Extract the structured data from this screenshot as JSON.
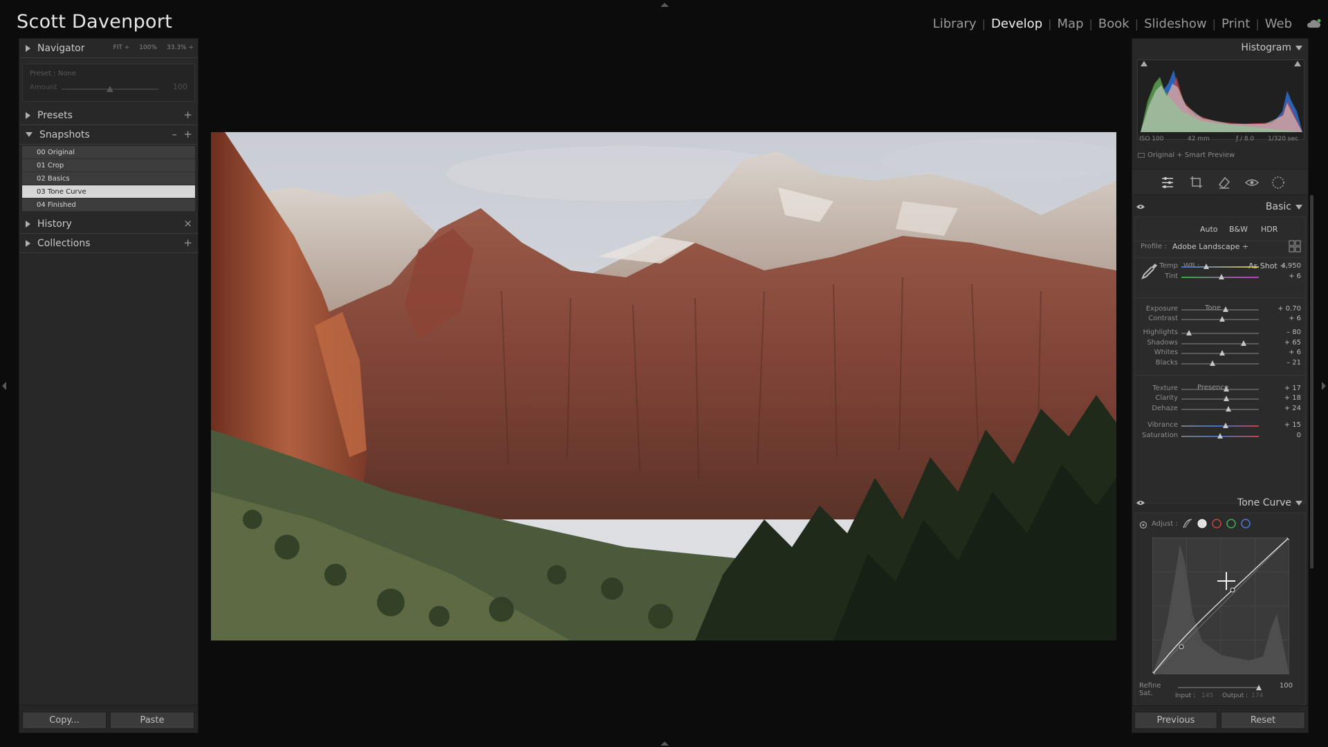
{
  "identity_plate": "Scott Davenport",
  "modules": [
    {
      "label": "Library",
      "active": false
    },
    {
      "label": "Develop",
      "active": true
    },
    {
      "label": "Map",
      "active": false
    },
    {
      "label": "Book",
      "active": false
    },
    {
      "label": "Slideshow",
      "active": false
    },
    {
      "label": "Print",
      "active": false
    },
    {
      "label": "Web",
      "active": false
    }
  ],
  "navigator": {
    "label": "Navigator",
    "zoom_options": [
      "FIT ÷",
      "100%",
      "33.3% ÷"
    ],
    "preset_text": "Preset : None",
    "amount_label": "Amount",
    "amount_value": "100"
  },
  "presets": {
    "label": "Presets",
    "action": "+"
  },
  "snapshots": {
    "label": "Snapshots",
    "actions": [
      "–",
      "+"
    ],
    "items": [
      "00 Original",
      "01 Crop",
      "02 Basics",
      "03 Tone Curve",
      "04 Finished"
    ],
    "selected_index": 3
  },
  "history": {
    "label": "History",
    "action": "×"
  },
  "collections": {
    "label": "Collections",
    "action": "+"
  },
  "left_buttons": {
    "copy": "Copy...",
    "paste": "Paste"
  },
  "histogram": {
    "label": "Histogram",
    "iso": "ISO 100",
    "focal": "42 mm",
    "aperture": "ƒ / 8.0",
    "shutter": "1/320 sec",
    "preview": "Original + Smart Preview"
  },
  "basic": {
    "label": "Basic",
    "buttons": [
      "Auto",
      "B&W",
      "HDR"
    ],
    "profile_label": "Profile :",
    "profile_value": "Adobe Landscape ÷",
    "wb_label": "WB :",
    "wb_value": "As Shot ÷",
    "tone_label": "Tone",
    "presence_label": "Presence",
    "sliders": [
      {
        "label": "Temp",
        "value": "4,950",
        "pos": 0.32
      },
      {
        "label": "Tint",
        "value": "+ 6",
        "pos": 0.52
      },
      {
        "label": "Exposure",
        "value": "+ 0.70",
        "pos": 0.57
      },
      {
        "label": "Contrast",
        "value": "+ 6",
        "pos": 0.53
      },
      {
        "label": "Highlights",
        "value": "– 80",
        "pos": 0.1
      },
      {
        "label": "Shadows",
        "value": "+ 65",
        "pos": 0.8
      },
      {
        "label": "Whites",
        "value": "+ 6",
        "pos": 0.53
      },
      {
        "label": "Blacks",
        "value": "– 21",
        "pos": 0.4
      },
      {
        "label": "Texture",
        "value": "+ 17",
        "pos": 0.58
      },
      {
        "label": "Clarity",
        "value": "+ 18",
        "pos": 0.58
      },
      {
        "label": "Dehaze",
        "value": "+ 24",
        "pos": 0.61
      },
      {
        "label": "Vibrance",
        "value": "+ 15",
        "pos": 0.57
      },
      {
        "label": "Saturation",
        "value": "0",
        "pos": 0.5
      }
    ]
  },
  "tone_curve": {
    "label": "Tone Curve",
    "adjust_label": "Adjust :",
    "refine_label": "Refine Sat.",
    "refine_value": "100",
    "refine_pos": 0.99,
    "input_label": "Input :",
    "input_value": "145",
    "output_label": "Output :",
    "output_value": "174"
  },
  "right_buttons": {
    "previous": "Previous",
    "reset": "Reset"
  }
}
